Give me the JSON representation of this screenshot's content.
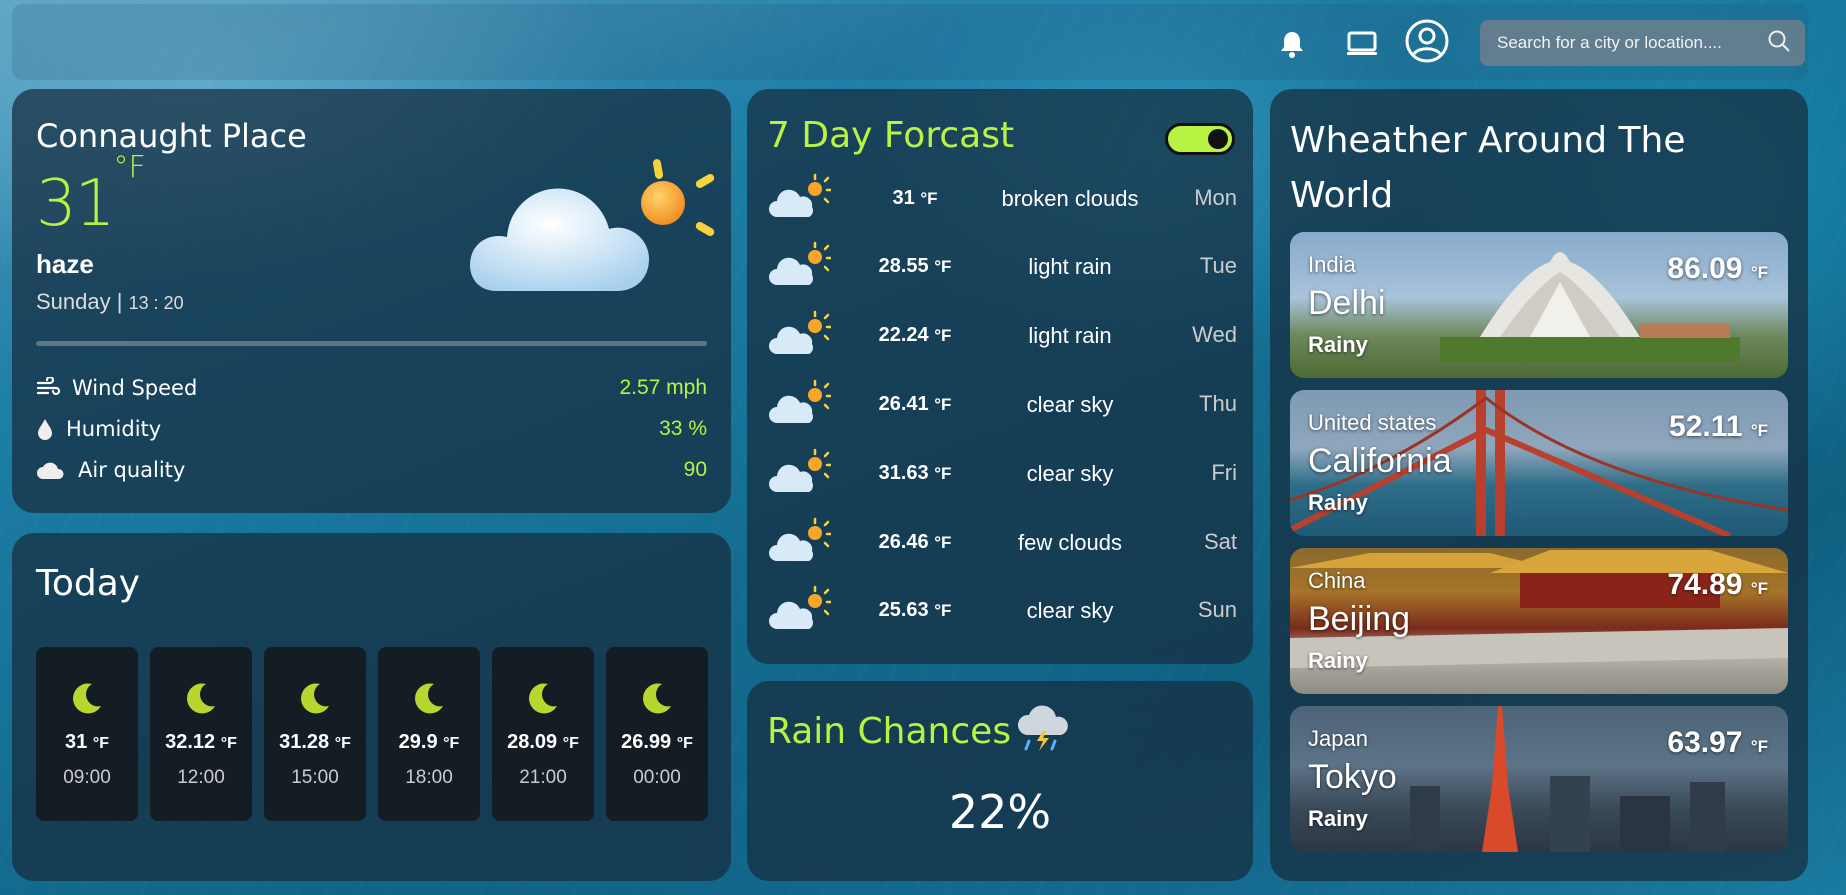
{
  "search": {
    "placeholder": "Search for a city or location...."
  },
  "icons": {
    "notifications": "bell-icon",
    "display": "monitor-icon",
    "account": "user-circle-icon",
    "search": "search-icon"
  },
  "current": {
    "city": "Connaught Place",
    "temp": "31",
    "unit": "°F",
    "condition": "haze",
    "day": "Sunday | ",
    "time": "13 : 20",
    "stats": [
      {
        "label": "Wind Speed",
        "value": "2.57 mph",
        "icon": "wind-icon"
      },
      {
        "label": "Humidity",
        "value": "33 %",
        "icon": "droplet-icon"
      },
      {
        "label": "Air quality",
        "value": "90",
        "icon": "cloud-icon"
      }
    ]
  },
  "today": {
    "title": "Today",
    "hours": [
      {
        "temp": "31",
        "unit": "°F",
        "time": "09:00"
      },
      {
        "temp": "32.12",
        "unit": "°F",
        "time": "12:00"
      },
      {
        "temp": "31.28",
        "unit": "°F",
        "time": "15:00"
      },
      {
        "temp": "29.9",
        "unit": "°F",
        "time": "18:00"
      },
      {
        "temp": "28.09",
        "unit": "°F",
        "time": "21:00"
      },
      {
        "temp": "26.99",
        "unit": "°F",
        "time": "00:00"
      }
    ]
  },
  "forecast": {
    "title": "7 Day Forcast",
    "toggle_on": true,
    "days": [
      {
        "temp": "31",
        "unit": "°F",
        "desc": "broken clouds",
        "day": "Mon"
      },
      {
        "temp": "28.55",
        "unit": "°F",
        "desc": "light rain",
        "day": "Tue"
      },
      {
        "temp": "22.24",
        "unit": "°F",
        "desc": "light rain",
        "day": "Wed"
      },
      {
        "temp": "26.41",
        "unit": "°F",
        "desc": "clear sky",
        "day": "Thu"
      },
      {
        "temp": "31.63",
        "unit": "°F",
        "desc": "clear sky",
        "day": "Fri"
      },
      {
        "temp": "26.46",
        "unit": "°F",
        "desc": "few clouds",
        "day": "Sat"
      },
      {
        "temp": "25.63",
        "unit": "°F",
        "desc": "clear sky",
        "day": "Sun"
      }
    ]
  },
  "rain": {
    "title": "Rain Chances",
    "value": "22%"
  },
  "world": {
    "title": "Wheather Around The World",
    "cities": [
      {
        "country": "India",
        "city": "Delhi",
        "condition": "Rainy",
        "temp": "86.09",
        "unit": "°F"
      },
      {
        "country": "United states",
        "city": "California",
        "condition": "Rainy",
        "temp": "52.11",
        "unit": "°F"
      },
      {
        "country": "China",
        "city": "Beijing",
        "condition": "Rainy",
        "temp": "74.89",
        "unit": "°F"
      },
      {
        "country": "Japan",
        "city": "Tokyo",
        "condition": "Rainy",
        "temp": "63.97",
        "unit": "°F"
      }
    ]
  },
  "colors": {
    "accent": "#b8f243",
    "card": "#162d3e"
  }
}
